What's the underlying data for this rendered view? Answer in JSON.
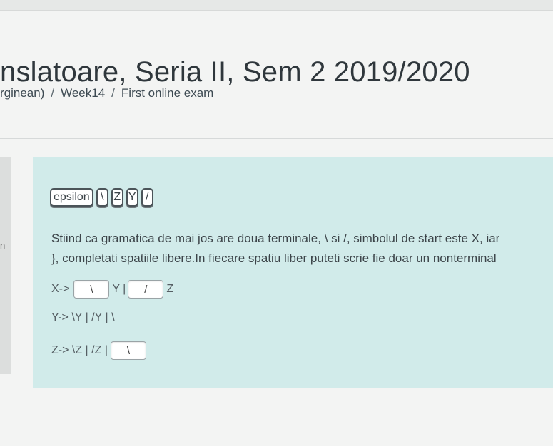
{
  "page": {
    "title": "nslatoare, Seria II, Sem 2 2019/2020",
    "breadcrumb": [
      "rginean)",
      "Week14",
      "First online exam"
    ],
    "breadcrumb_separator": "/",
    "left_glyph": "n"
  },
  "question": {
    "tokens": [
      "epsilon",
      "\\",
      "Z",
      "Y",
      "/"
    ],
    "text_line1": "Stiind ca gramatica de mai jos are doua terminale, \\ si /, simbolul de start este X, iar",
    "text_line2": "}, completati spatiile libere.In fiecare spatiu liber puteti scrie fie doar un nonterminal",
    "rule_x": {
      "prefix": "X->",
      "blank1": "\\",
      "middle": "Y |",
      "blank2": "/",
      "suffix": "Z"
    },
    "rule_y": {
      "text": "Y-> \\Y | /Y | \\"
    },
    "rule_z": {
      "prefix": "Z-> \\Z | /Z |",
      "blank": "\\"
    }
  },
  "colors": {
    "panel": "#d1ebea",
    "page": "#f3f4f3"
  }
}
